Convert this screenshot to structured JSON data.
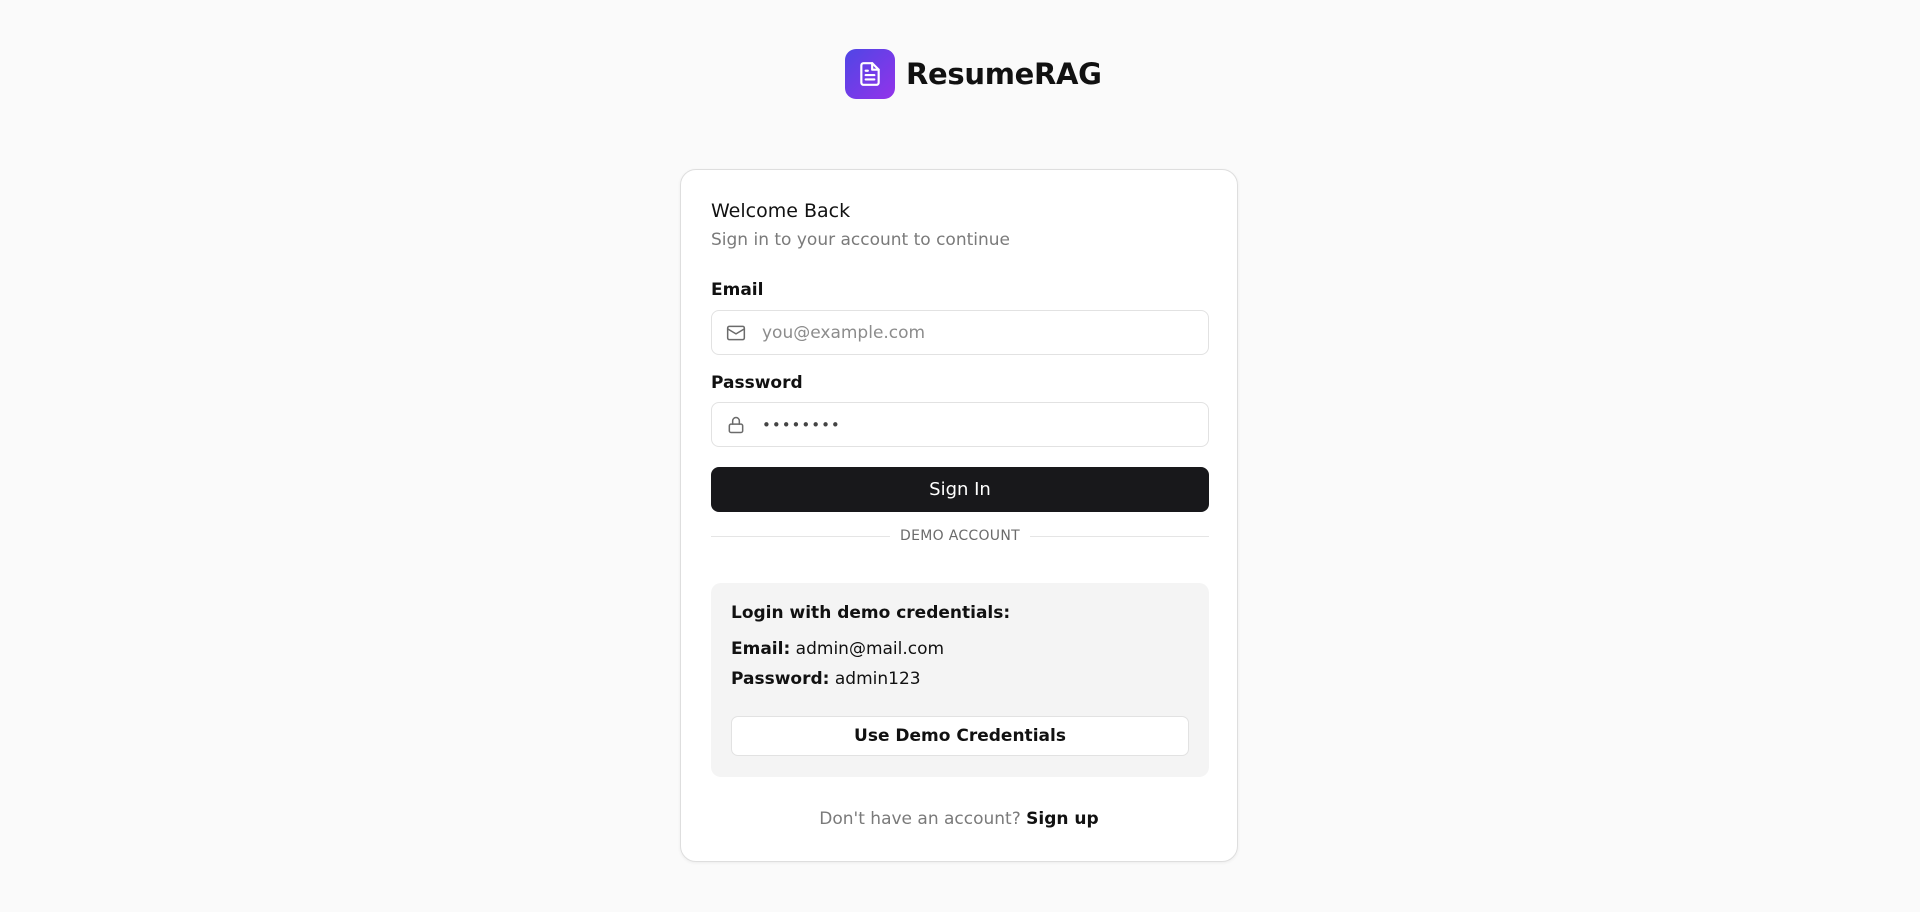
{
  "brand": {
    "name": "ResumeRAG",
    "logo_icon": "document-icon",
    "gradient_from": "#4f46e5",
    "gradient_to": "#9333ea"
  },
  "card": {
    "title": "Welcome Back",
    "subtitle": "Sign in to your account to continue"
  },
  "form": {
    "email_label": "Email",
    "email_placeholder": "you@example.com",
    "email_value": "",
    "email_icon": "mail-icon",
    "password_label": "Password",
    "password_value": "••••••••",
    "password_icon": "lock-icon",
    "submit_label": "Sign In"
  },
  "divider": {
    "text": "DEMO ACCOUNT"
  },
  "demo": {
    "heading": "Login with demo credentials:",
    "email_key": "Email:",
    "email_value": "admin@mail.com",
    "password_key": "Password:",
    "password_value": "admin123",
    "button_label": "Use Demo Credentials"
  },
  "footer": {
    "prompt": "Don't have an account?",
    "link": "Sign up"
  },
  "colors": {
    "page_bg": "#fafafa",
    "primary_button": "#18181b",
    "demo_box_bg": "#f4f4f4"
  }
}
